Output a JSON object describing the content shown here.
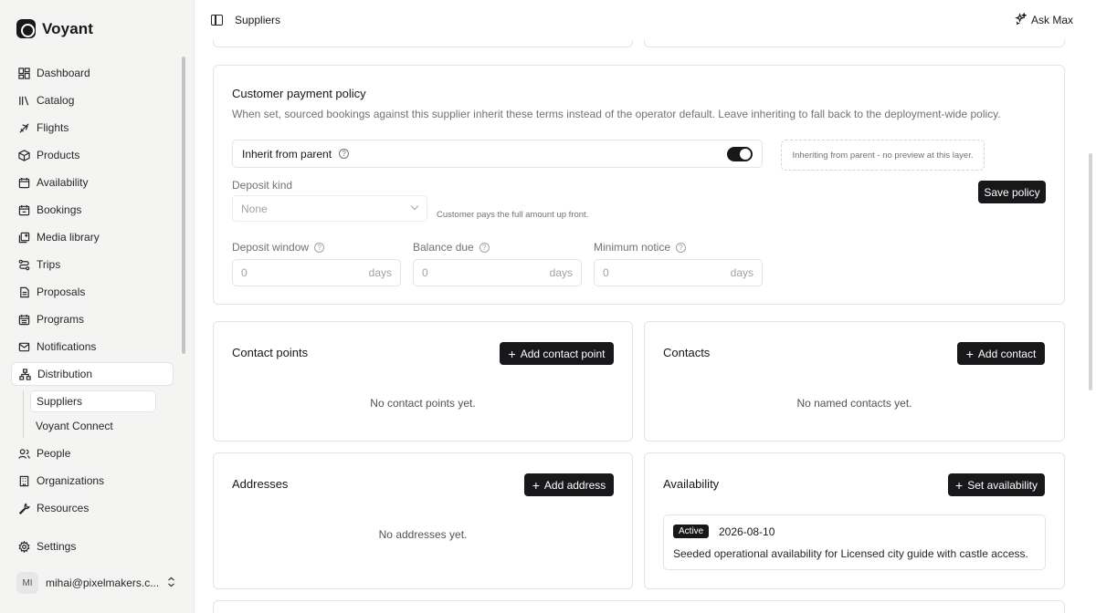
{
  "brand": {
    "name": "Voyant"
  },
  "sidebar": {
    "items": [
      {
        "label": "Dashboard",
        "icon": "dashboard-icon"
      },
      {
        "label": "Catalog",
        "icon": "library-icon"
      },
      {
        "label": "Flights",
        "icon": "plane-icon"
      },
      {
        "label": "Products",
        "icon": "box-icon"
      },
      {
        "label": "Availability",
        "icon": "calendar-icon"
      },
      {
        "label": "Bookings",
        "icon": "calendar-check-icon"
      },
      {
        "label": "Media library",
        "icon": "images-icon"
      },
      {
        "label": "Trips",
        "icon": "route-icon"
      },
      {
        "label": "Proposals",
        "icon": "document-icon"
      },
      {
        "label": "Programs",
        "icon": "calendar-grid-icon"
      },
      {
        "label": "Notifications",
        "icon": "mail-icon"
      },
      {
        "label": "Distribution",
        "icon": "network-icon"
      },
      {
        "label": "People",
        "icon": "users-icon"
      },
      {
        "label": "Organizations",
        "icon": "building-icon"
      },
      {
        "label": "Resources",
        "icon": "wrench-icon"
      },
      {
        "label": "Settings",
        "icon": "gear-icon"
      }
    ],
    "sub_items": [
      {
        "label": "Suppliers"
      },
      {
        "label": "Voyant Connect"
      }
    ],
    "user": {
      "initials": "MI",
      "email": "mihai@pixelmakers.c..."
    }
  },
  "topbar": {
    "breadcrumb": "Suppliers",
    "ask_label": "Ask Max"
  },
  "policy": {
    "title": "Customer payment policy",
    "description": "When set, sourced bookings against this supplier inherit these terms instead of the operator default. Leave inheriting to fall back to the deployment-wide policy.",
    "inherit_label": "Inherit from parent",
    "inherit_on": true,
    "preview_note": "Inheriting from parent - no preview at this layer.",
    "save_label": "Save policy",
    "deposit_kind_label": "Deposit kind",
    "deposit_kind_value": "None",
    "deposit_kind_hint": "Customer pays the full amount up front.",
    "fields": [
      {
        "label": "Deposit window",
        "value": "0",
        "unit": "days"
      },
      {
        "label": "Balance due",
        "value": "0",
        "unit": "days"
      },
      {
        "label": "Minimum notice",
        "value": "0",
        "unit": "days"
      }
    ]
  },
  "contact_points": {
    "title": "Contact points",
    "button": "Add contact point",
    "empty": "No contact points yet."
  },
  "contacts": {
    "title": "Contacts",
    "button": "Add contact",
    "empty": "No named contacts yet."
  },
  "addresses": {
    "title": "Addresses",
    "button": "Add address",
    "empty": "No addresses yet."
  },
  "availability": {
    "title": "Availability",
    "button": "Set availability",
    "entry": {
      "status": "Active",
      "date": "2026-08-10",
      "description": "Seeded operational availability for Licensed city guide with castle access."
    }
  }
}
